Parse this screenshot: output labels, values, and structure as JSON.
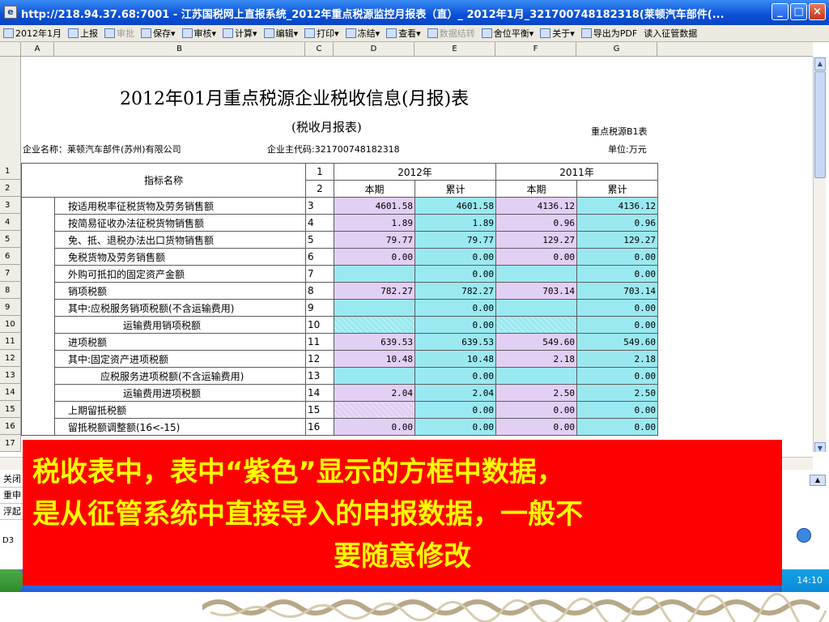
{
  "window": {
    "title": "http://218.94.37.68:7001 - 江苏国税网上直报系统_2012年重点税源监控月报表（直）_ 2012年1月_321700748182318(莱顿汽车部件(...",
    "buttons": [
      "_",
      "□",
      "×"
    ]
  },
  "toolbar": {
    "items": [
      {
        "label": "2012年1月",
        "icon": "calendar-icon",
        "enabled": true
      },
      {
        "label": "上报",
        "icon": "upload-icon",
        "enabled": true
      },
      {
        "label": "审批",
        "icon": "approve-icon",
        "enabled": false
      },
      {
        "label": "保存▾",
        "icon": "save-icon",
        "enabled": true
      },
      {
        "label": "审核▾",
        "icon": "check-icon",
        "enabled": true
      },
      {
        "label": "计算▾",
        "icon": "calculator-icon",
        "enabled": true
      },
      {
        "label": "编辑▾",
        "icon": "edit-icon",
        "enabled": true
      },
      {
        "label": "打印▾",
        "icon": "print-icon",
        "enabled": true
      },
      {
        "label": "冻结▾",
        "icon": "freeze-icon",
        "enabled": true
      },
      {
        "label": "查看▾",
        "icon": "view-icon",
        "enabled": true
      },
      {
        "label": "数据结转",
        "icon": "transfer-icon",
        "enabled": false
      },
      {
        "label": "舍位平衡▾",
        "icon": "balance-icon",
        "enabled": true
      },
      {
        "label": "关于▾",
        "icon": "about-icon",
        "enabled": true
      },
      {
        "label": "导出为PDF",
        "icon": "pdf-icon",
        "enabled": true
      },
      {
        "label": "读入征管数据",
        "icon": "",
        "enabled": true
      }
    ]
  },
  "columns": [
    "A",
    "B",
    "C",
    "D",
    "E",
    "F",
    "G"
  ],
  "rows": [
    "1",
    "2",
    "3",
    "4",
    "5",
    "6",
    "7",
    "8",
    "9",
    "10",
    "11",
    "12",
    "13",
    "14",
    "15",
    "16",
    "17"
  ],
  "sheet": {
    "title": "2012年01月重点税源企业税收信息(月报)表",
    "subtitle": "(税收月报表)",
    "code": "重点税源B1表",
    "company": "企业名称：莱顿汽车部件(苏州)有限公司",
    "taxpayer_id": "企业主代码:321700748182318",
    "unit": "单位:万元",
    "header": {
      "item_name": "指标名称",
      "col1": "1",
      "col2": "2",
      "year_current": "2012年",
      "year_prior": "2011年",
      "current_period": "本期",
      "cumulative": "累计"
    },
    "lines": [
      {
        "name": "按适用税率征税货物及劳务销售额",
        "no": "3",
        "v": [
          "4601.58",
          "4601.58",
          "4136.12",
          "4136.12"
        ],
        "style": [
          "purple",
          "cyan",
          "purple",
          "cyan"
        ],
        "indent": 1
      },
      {
        "name": "按简易征收办法征税货物销售额",
        "no": "4",
        "v": [
          "1.89",
          "1.89",
          "0.96",
          "0.96"
        ],
        "style": [
          "purple",
          "cyan",
          "purple",
          "cyan"
        ],
        "indent": 1
      },
      {
        "name": "免、抵、退税办法出口货物销售额",
        "no": "5",
        "v": [
          "79.77",
          "79.77",
          "129.27",
          "129.27"
        ],
        "style": [
          "purple",
          "cyan",
          "purple",
          "cyan"
        ],
        "indent": 1
      },
      {
        "name": "免税货物及劳务销售额",
        "no": "6",
        "v": [
          "0.00",
          "0.00",
          "0.00",
          "0.00"
        ],
        "style": [
          "purple",
          "cyan",
          "purple",
          "cyan"
        ],
        "indent": 1
      },
      {
        "name": "外购可抵扣的固定资产金额",
        "no": "7",
        "v": [
          "",
          "0.00",
          "",
          "0.00"
        ],
        "style": [
          "cyan",
          "cyan",
          "cyan",
          "cyan"
        ],
        "indent": 1
      },
      {
        "name": "销项税额",
        "no": "8",
        "v": [
          "782.27",
          "782.27",
          "703.14",
          "703.14"
        ],
        "style": [
          "purple",
          "cyan",
          "purple",
          "cyan"
        ],
        "indent": 1
      },
      {
        "name": "其中:应税服务销项税额(不含运输费用)",
        "no": "9",
        "v": [
          "",
          "0.00",
          "",
          "0.00"
        ],
        "style": [
          "cyan",
          "cyan",
          "cyan",
          "cyan"
        ],
        "indent": 1
      },
      {
        "name": "运输费用销项税额",
        "no": "10",
        "v": [
          "",
          "0.00",
          "",
          "0.00"
        ],
        "style": [
          "hatch",
          "cyan",
          "hatch",
          "cyan"
        ],
        "indent": 3
      },
      {
        "name": "进项税额",
        "no": "11",
        "v": [
          "639.53",
          "639.53",
          "549.60",
          "549.60"
        ],
        "style": [
          "purple",
          "cyan",
          "purple",
          "cyan"
        ],
        "indent": 1
      },
      {
        "name": "其中:固定资产进项税额",
        "no": "12",
        "v": [
          "10.48",
          "10.48",
          "2.18",
          "2.18"
        ],
        "style": [
          "purple",
          "cyan",
          "purple",
          "cyan"
        ],
        "indent": 1
      },
      {
        "name": "应税服务进项税额(不含运输费用)",
        "no": "13",
        "v": [
          "",
          "0.00",
          "",
          "0.00"
        ],
        "style": [
          "cyan",
          "cyan",
          "cyan",
          "cyan"
        ],
        "indent": 2
      },
      {
        "name": "运输费用进项税额",
        "no": "14",
        "v": [
          "2.04",
          "2.04",
          "2.50",
          "2.50"
        ],
        "style": [
          "purple",
          "cyan",
          "purple",
          "cyan"
        ],
        "indent": 3
      },
      {
        "name": "上期留抵税额",
        "no": "15",
        "v": [
          "",
          "0.00",
          "0.00",
          "0.00"
        ],
        "style": [
          "hatchp",
          "cyan",
          "purple",
          "cyan"
        ],
        "indent": 1
      },
      {
        "name": "留抵税额调整额(16<-15)",
        "no": "16",
        "v": [
          "0.00",
          "0.00",
          "0.00",
          "0.00"
        ],
        "style": [
          "purple",
          "cyan",
          "purple",
          "cyan"
        ],
        "indent": 1
      }
    ]
  },
  "bottom_panel": {
    "lines": [
      "关闭",
      "重申",
      "浮起"
    ],
    "cell_ref": "D3"
  },
  "taskbar": {
    "clock": "14:10"
  },
  "banner": {
    "line1": "税收表中，表中“紫色”显示的方框中数据，",
    "line2": "是从征管系统中直接导入的申报数据，一般不",
    "line3": "要随意修改"
  }
}
